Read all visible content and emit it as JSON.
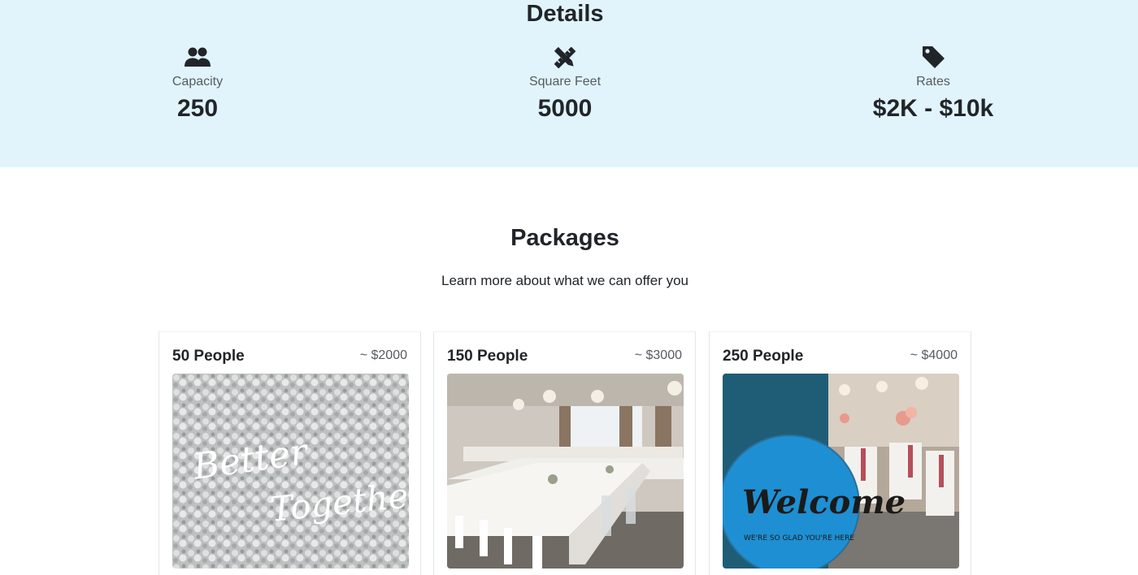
{
  "details": {
    "title": "Details",
    "stats": [
      {
        "icon": "people-icon",
        "label": "Capacity",
        "value": "250"
      },
      {
        "icon": "ruler-pencil-icon",
        "label": "Square Feet",
        "value": "5000"
      },
      {
        "icon": "price-tag-icon",
        "label": "Rates",
        "value": "$2K - $10k"
      }
    ]
  },
  "packages": {
    "title": "Packages",
    "subtitle": "Learn more about what we can offer you",
    "cards": [
      {
        "title": "50 People",
        "price": "~ $2000",
        "image": "flower-wall-photo",
        "script_1": "Better",
        "script_2": "Together"
      },
      {
        "title": "150 People",
        "price": "~ $3000",
        "image": "banquet-hall-photo"
      },
      {
        "title": "250 People",
        "price": "~ $4000",
        "image": "welcome-sign-photo",
        "sign_main": "Welcome",
        "sign_sub": "WE'RE SO GLAD YOU'RE HERE"
      }
    ]
  },
  "colors": {
    "details_bg": "#e1f4fb",
    "text": "#212529",
    "muted": "#555b61",
    "card_border": "#e3e6e8"
  }
}
